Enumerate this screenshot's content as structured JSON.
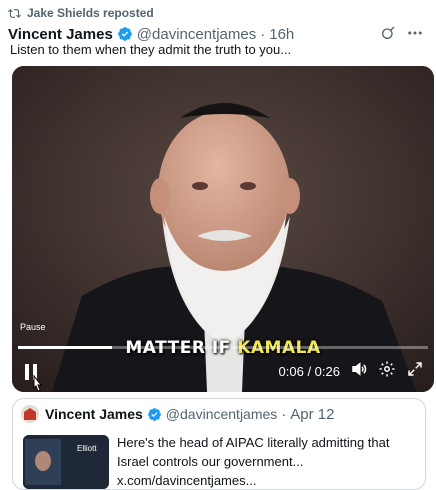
{
  "repost": {
    "text": "Jake Shields reposted"
  },
  "tweet": {
    "author_name": "Vincent James",
    "handle": "@davincentjames",
    "separator": "·",
    "time": "16h",
    "text": "Listen to them when they admit the truth to you..."
  },
  "video": {
    "caption_white": "MATTER IF ",
    "caption_highlight": "KAMALA",
    "pause_tooltip": "Pause",
    "time_display": "0:06 / 0:26",
    "progress": 0.23,
    "colors": {
      "highlight": "#f2e64a"
    }
  },
  "quoted": {
    "author_name": "Vincent James",
    "handle": "@davincentjames",
    "separator": "·",
    "date": "Apr 12",
    "text": "Here's the head of AIPAC literally admitting that Israel controls our government... x.com/davincentjames...",
    "thumb_text": "Elliott"
  },
  "colors": {
    "verified": "#1d9bf0",
    "secondary_text": "#536471",
    "border": "#cfd9de"
  },
  "icons": {
    "repost": "repost-icon",
    "grok": "grok-icon",
    "more": "more-icon",
    "play_pause": "pause-icon",
    "volume": "volume-icon",
    "settings": "gear-icon",
    "fullscreen": "fullscreen-icon"
  }
}
